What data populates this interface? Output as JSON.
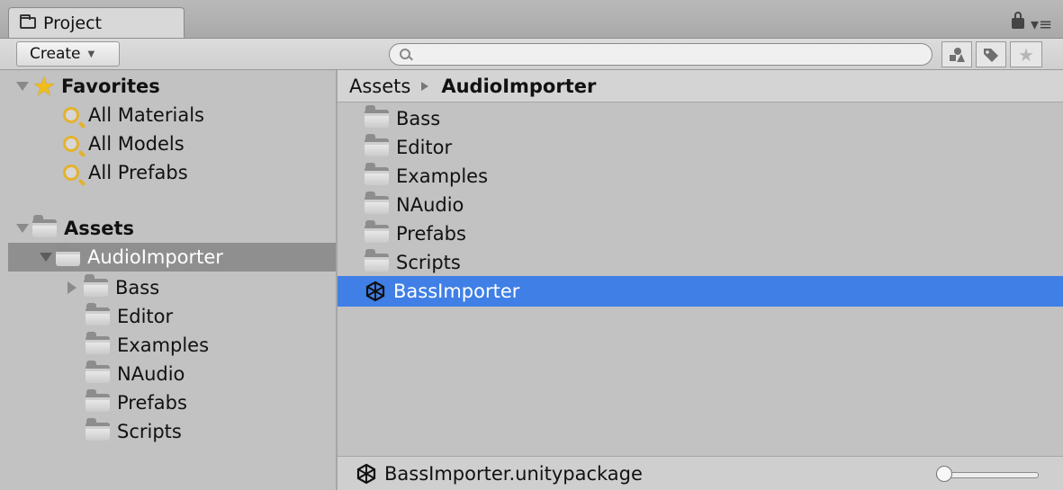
{
  "window": {
    "tab_label": "Project",
    "menu_glyph": "▾≡"
  },
  "toolbar": {
    "create_label": "Create",
    "search": {
      "placeholder": "",
      "value": ""
    },
    "buttons": [
      "filter-by-type",
      "filter-by-label",
      "favorites"
    ]
  },
  "sidebar": {
    "favorites": {
      "label": "Favorites",
      "items": [
        "All Materials",
        "All Models",
        "All Prefabs"
      ]
    },
    "assets": {
      "label": "Assets",
      "selected_item": "AudioImporter",
      "children": [
        "Bass",
        "Editor",
        "Examples",
        "NAudio",
        "Prefabs",
        "Scripts"
      ]
    }
  },
  "main": {
    "breadcrumb": [
      "Assets",
      "AudioImporter"
    ],
    "items": [
      "Bass",
      "Editor",
      "Examples",
      "NAudio",
      "Prefabs",
      "Scripts",
      "BassImporter"
    ],
    "selected_item": "BassImporter"
  },
  "status": {
    "selected_asset": "BassImporter.unitypackage",
    "zoom": 0
  },
  "colors": {
    "selection_blue": "#3f7fe6",
    "sidebar_selection": "#8f8f8f",
    "panel_bg": "#c2c2c2"
  },
  "icons": {
    "folder": "folder-icon",
    "favorite": "star-icon",
    "search": "search-icon",
    "unity_package": "unity-icon",
    "lock": "lock-icon"
  }
}
